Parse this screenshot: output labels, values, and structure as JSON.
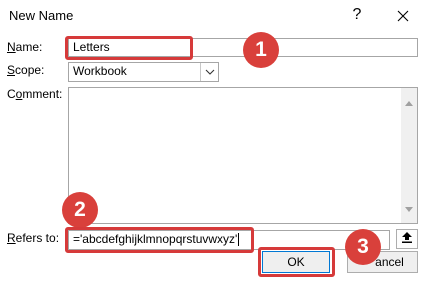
{
  "window": {
    "title": "New Name",
    "help_label": "?",
    "close_label": "✕"
  },
  "name": {
    "label_prefix": "",
    "label_underlined": "N",
    "label_rest": "ame:",
    "value": "Letters"
  },
  "scope": {
    "label_underlined": "S",
    "label_rest": "cope:",
    "value": "Workbook"
  },
  "comment": {
    "label_prefix": "C",
    "label_underlined": "o",
    "label_rest": "mment:",
    "value": ""
  },
  "refers_to": {
    "label_underlined": "R",
    "label_rest": "efers to:",
    "value": "='abcdefghijklmnopqrstuvwxyz'"
  },
  "buttons": {
    "ok": "OK",
    "cancel": "ancel"
  },
  "badges": [
    "1",
    "2",
    "3"
  ],
  "colors": {
    "highlight": "#d63a3a",
    "badge": "#d9403b",
    "default_button_border": "#0078d4"
  }
}
